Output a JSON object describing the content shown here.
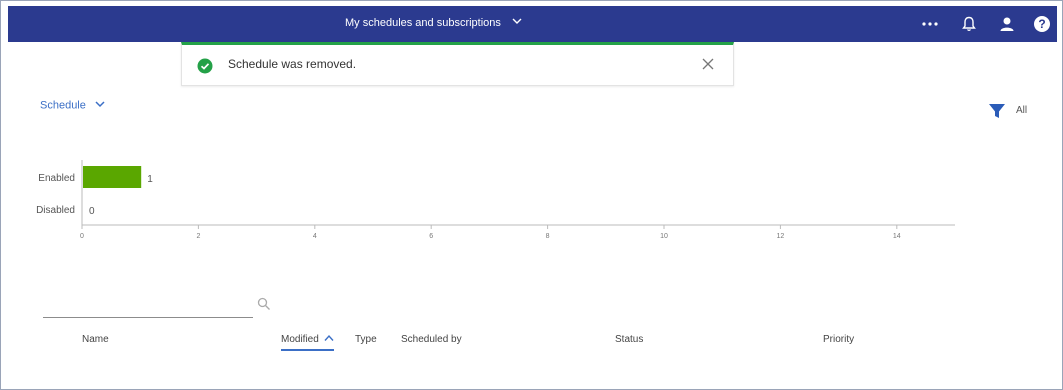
{
  "header": {
    "title": "My schedules and subscriptions",
    "background": "#2b3a8f",
    "icons": [
      "more-icon",
      "bell-icon",
      "user-icon",
      "help-icon"
    ]
  },
  "toast": {
    "message": "Schedule was removed.",
    "status_color": "#24a148",
    "icons": [
      "check-circle-icon",
      "close-icon"
    ]
  },
  "view_selector": {
    "label": "Schedule"
  },
  "filter": {
    "label": "All",
    "icon": "filter-icon"
  },
  "chart_data": {
    "type": "bar",
    "orientation": "horizontal",
    "categories": [
      "Enabled",
      "Disabled"
    ],
    "values": [
      1,
      0
    ],
    "xlim": [
      0,
      15
    ],
    "xticks": [
      0,
      2,
      4,
      6,
      8,
      10,
      12,
      14
    ],
    "bar_color": "#5aa700",
    "grid": false
  },
  "search": {
    "value": "",
    "placeholder": ""
  },
  "table": {
    "columns": [
      "Name",
      "Modified",
      "Type",
      "Scheduled by",
      "Status",
      "Priority"
    ],
    "sorted_column": "Modified",
    "sort_direction": "ascending",
    "rows": []
  }
}
